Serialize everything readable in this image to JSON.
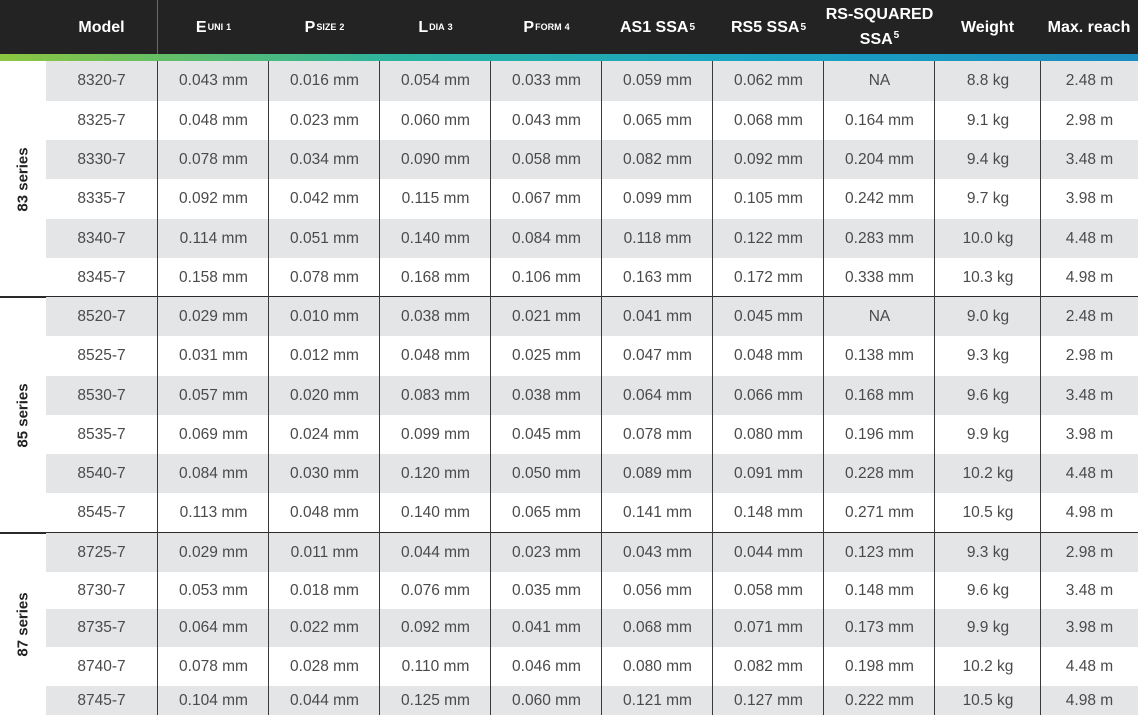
{
  "headers": {
    "model": "Model",
    "e_uni": {
      "base": "E",
      "sub": "UNI",
      "sup": "1"
    },
    "p_size": {
      "base": "P",
      "sub": "SIZE",
      "sup": "2"
    },
    "l_dia": {
      "base": "L",
      "sub": "DIA",
      "sup": "3"
    },
    "p_form": {
      "base": "P",
      "sub": "FORM",
      "sup": "4"
    },
    "as1_ssa": {
      "text": "AS1 SSA",
      "sup": "5"
    },
    "rs5_ssa": {
      "text": "RS5 SSA",
      "sup": "5"
    },
    "rs_squared_ssa": {
      "line1": "RS-SQUARED",
      "line2": "SSA",
      "sup": "5"
    },
    "weight": "Weight",
    "max_reach": "Max. reach"
  },
  "groups": [
    {
      "label": "83 series",
      "rows": [
        [
          "8320-7",
          "0.043 mm",
          "0.016 mm",
          "0.054 mm",
          "0.033 mm",
          "0.059 mm",
          "0.062 mm",
          "NA",
          "8.8 kg",
          "2.48 m"
        ],
        [
          "8325-7",
          "0.048 mm",
          "0.023 mm",
          "0.060 mm",
          "0.043 mm",
          "0.065 mm",
          "0.068 mm",
          "0.164 mm",
          "9.1 kg",
          "2.98 m"
        ],
        [
          "8330-7",
          "0.078 mm",
          "0.034 mm",
          "0.090 mm",
          "0.058 mm",
          "0.082 mm",
          "0.092 mm",
          "0.204 mm",
          "9.4 kg",
          "3.48 m"
        ],
        [
          "8335-7",
          "0.092 mm",
          "0.042 mm",
          "0.115 mm",
          "0.067 mm",
          "0.099 mm",
          "0.105 mm",
          "0.242 mm",
          "9.7 kg",
          "3.98 m"
        ],
        [
          "8340-7",
          "0.114 mm",
          "0.051 mm",
          "0.140 mm",
          "0.084 mm",
          "0.118 mm",
          "0.122 mm",
          "0.283 mm",
          "10.0 kg",
          "4.48 m"
        ],
        [
          "8345-7",
          "0.158 mm",
          "0.078 mm",
          "0.168 mm",
          "0.106 mm",
          "0.163 mm",
          "0.172 mm",
          "0.338 mm",
          "10.3 kg",
          "4.98 m"
        ]
      ]
    },
    {
      "label": "85 series",
      "rows": [
        [
          "8520-7",
          "0.029 mm",
          "0.010 mm",
          "0.038 mm",
          "0.021 mm",
          "0.041 mm",
          "0.045 mm",
          "NA",
          "9.0 kg",
          "2.48 m"
        ],
        [
          "8525-7",
          "0.031 mm",
          "0.012 mm",
          "0.048 mm",
          "0.025 mm",
          "0.047 mm",
          "0.048 mm",
          "0.138 mm",
          "9.3 kg",
          "2.98 m"
        ],
        [
          "8530-7",
          "0.057 mm",
          "0.020 mm",
          "0.083 mm",
          "0.038 mm",
          "0.064 mm",
          "0.066 mm",
          "0.168 mm",
          "9.6 kg",
          "3.48 m"
        ],
        [
          "8535-7",
          "0.069 mm",
          "0.024 mm",
          "0.099 mm",
          "0.045 mm",
          "0.078 mm",
          "0.080 mm",
          "0.196 mm",
          "9.9 kg",
          "3.98 m"
        ],
        [
          "8540-7",
          "0.084 mm",
          "0.030 mm",
          "0.120 mm",
          "0.050 mm",
          "0.089 mm",
          "0.091 mm",
          "0.228 mm",
          "10.2 kg",
          "4.48 m"
        ],
        [
          "8545-7",
          "0.113 mm",
          "0.048 mm",
          "0.140 mm",
          "0.065 mm",
          "0.141 mm",
          "0.148 mm",
          "0.271 mm",
          "10.5 kg",
          "4.98 m"
        ]
      ]
    },
    {
      "label": "87 series",
      "rows": [
        [
          "8725-7",
          "0.029 mm",
          "0.011 mm",
          "0.044 mm",
          "0.023 mm",
          "0.043 mm",
          "0.044 mm",
          "0.123 mm",
          "9.3 kg",
          "2.98 m"
        ],
        [
          "8730-7",
          "0.053 mm",
          "0.018 mm",
          "0.076 mm",
          "0.035 mm",
          "0.056 mm",
          "0.058 mm",
          "0.148 mm",
          "9.6 kg",
          "3.48 m"
        ],
        [
          "8735-7",
          "0.064 mm",
          "0.022 mm",
          "0.092 mm",
          "0.041 mm",
          "0.068 mm",
          "0.071 mm",
          "0.173 mm",
          "9.9 kg",
          "3.98 m"
        ],
        [
          "8740-7",
          "0.078 mm",
          "0.028 mm",
          "0.110 mm",
          "0.046 mm",
          "0.080 mm",
          "0.082 mm",
          "0.198 mm",
          "10.2 kg",
          "4.48 m"
        ],
        [
          "8745-7",
          "0.104 mm",
          "0.044 mm",
          "0.125 mm",
          "0.060 mm",
          "0.121 mm",
          "0.127 mm",
          "0.222 mm",
          "10.5 kg",
          "4.98 m"
        ]
      ]
    }
  ]
}
